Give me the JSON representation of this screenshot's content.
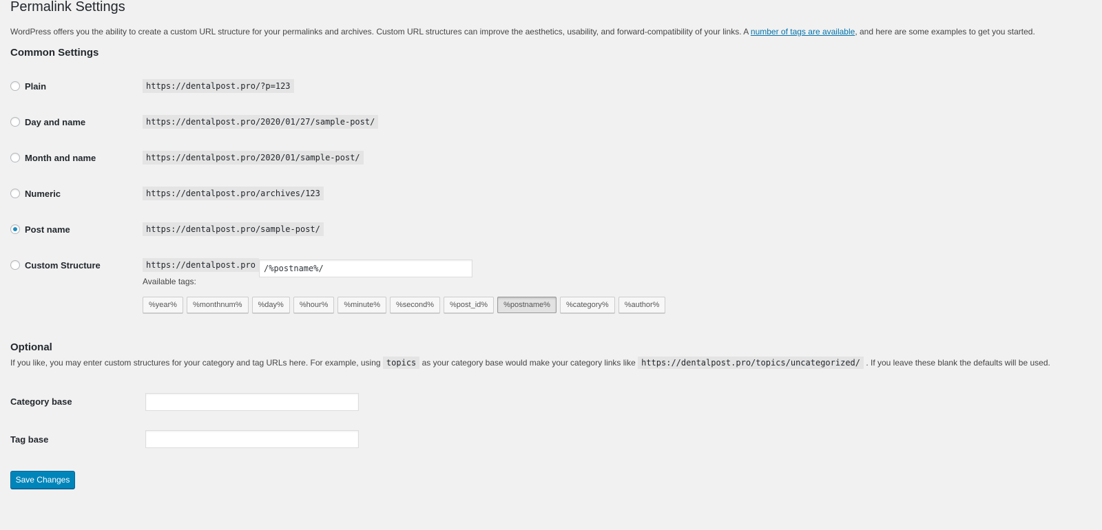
{
  "page": {
    "title": "Permalink Settings",
    "intro_before": "WordPress offers you the ability to create a custom URL structure for your permalinks and archives. Custom URL structures can improve the aesthetics, usability, and forward-compatibility of your links. A ",
    "intro_link": "number of tags are available",
    "intro_after": ", and here are some examples to get you started."
  },
  "common": {
    "heading": "Common Settings",
    "options": [
      {
        "label": "Plain",
        "url": "https://dentalpost.pro/?p=123",
        "checked": false
      },
      {
        "label": "Day and name",
        "url": "https://dentalpost.pro/2020/01/27/sample-post/",
        "checked": false
      },
      {
        "label": "Month and name",
        "url": "https://dentalpost.pro/2020/01/sample-post/",
        "checked": false
      },
      {
        "label": "Numeric",
        "url": "https://dentalpost.pro/archives/123",
        "checked": false
      },
      {
        "label": "Post name",
        "url": "https://dentalpost.pro/sample-post/",
        "checked": true
      },
      {
        "label": "Custom Structure",
        "url": "https://dentalpost.pro",
        "checked": false
      }
    ],
    "custom_value": "/%postname%/",
    "available_tags_label": "Available tags:",
    "tags": [
      "%year%",
      "%monthnum%",
      "%day%",
      "%hour%",
      "%minute%",
      "%second%",
      "%post_id%",
      "%postname%",
      "%category%",
      "%author%"
    ],
    "active_tag": "%postname%"
  },
  "optional": {
    "heading": "Optional",
    "desc_1": "If you like, you may enter custom structures for your category and tag URLs here. For example, using ",
    "code_1": "topics",
    "desc_2": " as your category base would make your category links like ",
    "code_2": "https://dentalpost.pro/topics/uncategorized/",
    "desc_3": " . If you leave these blank the defaults will be used.",
    "category_label": "Category base",
    "category_value": "",
    "tag_label": "Tag base",
    "tag_value": ""
  },
  "save_label": "Save Changes",
  "colors": {
    "accent": "#0085ba",
    "link": "#0073aa",
    "background": "#f1f1f1"
  }
}
